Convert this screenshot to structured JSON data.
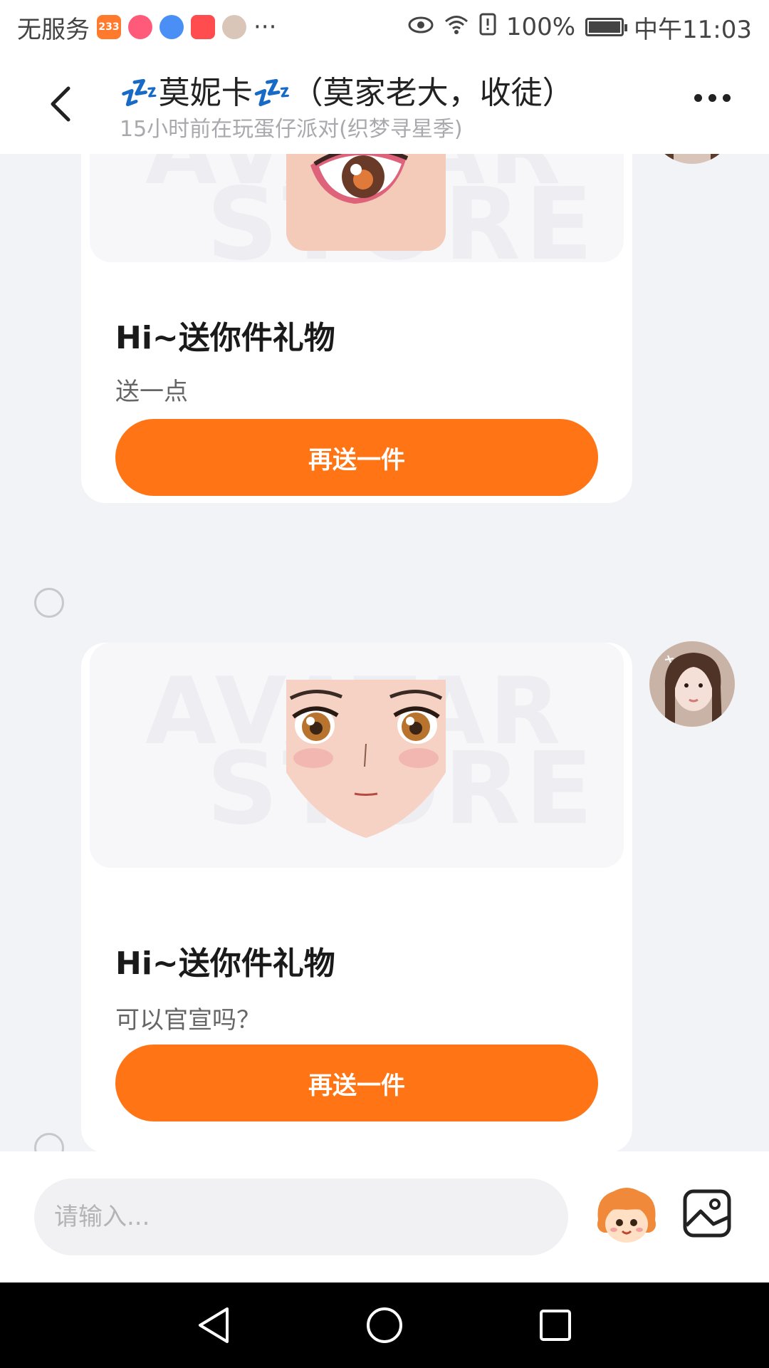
{
  "status_bar": {
    "carrier": "无服务",
    "app_badge_233": "233",
    "ellipsis": "···",
    "battery": "100%",
    "time": "中午11:03"
  },
  "header": {
    "title": "💤莫妮卡💤（莫家老大，收徒）",
    "subtitle": "15小时前在玩蛋仔派对(织梦寻星季)"
  },
  "messages": [
    {
      "title": "Hi~送你件礼物",
      "text": "送一点",
      "button_label": "再送一件",
      "gift": "eye-makeup"
    },
    {
      "title": "Hi~送你件礼物",
      "text": "可以官宣吗？",
      "button_label": "再送一件",
      "gift": "anime-face"
    }
  ],
  "watermark": {
    "line1": "AVATAR",
    "line2": "STORE"
  },
  "input": {
    "placeholder": "请输入..."
  },
  "colors": {
    "accent": "#ff7516",
    "background": "#f2f3f6"
  }
}
